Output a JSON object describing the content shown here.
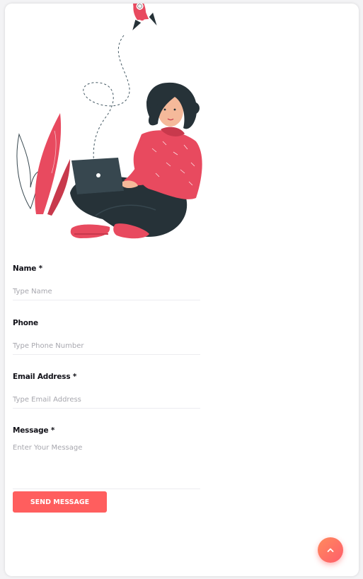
{
  "form": {
    "name": {
      "label": "Name *",
      "placeholder": "Type Name"
    },
    "phone": {
      "label": "Phone",
      "placeholder": "Type Phone Number"
    },
    "email": {
      "label": "Email Address *",
      "placeholder": "Type Email Address"
    },
    "message": {
      "label": "Message *",
      "placeholder": "Enter Your Message"
    },
    "submit_label": "SEND MESSAGE"
  },
  "scroll_top": {
    "icon": "chevron-up-icon"
  },
  "illustration": {
    "icon": "woman-with-laptop-illustration"
  },
  "colors": {
    "accent": "#ff5e5e",
    "shirt": "#e84a5f",
    "dark": "#263238"
  }
}
